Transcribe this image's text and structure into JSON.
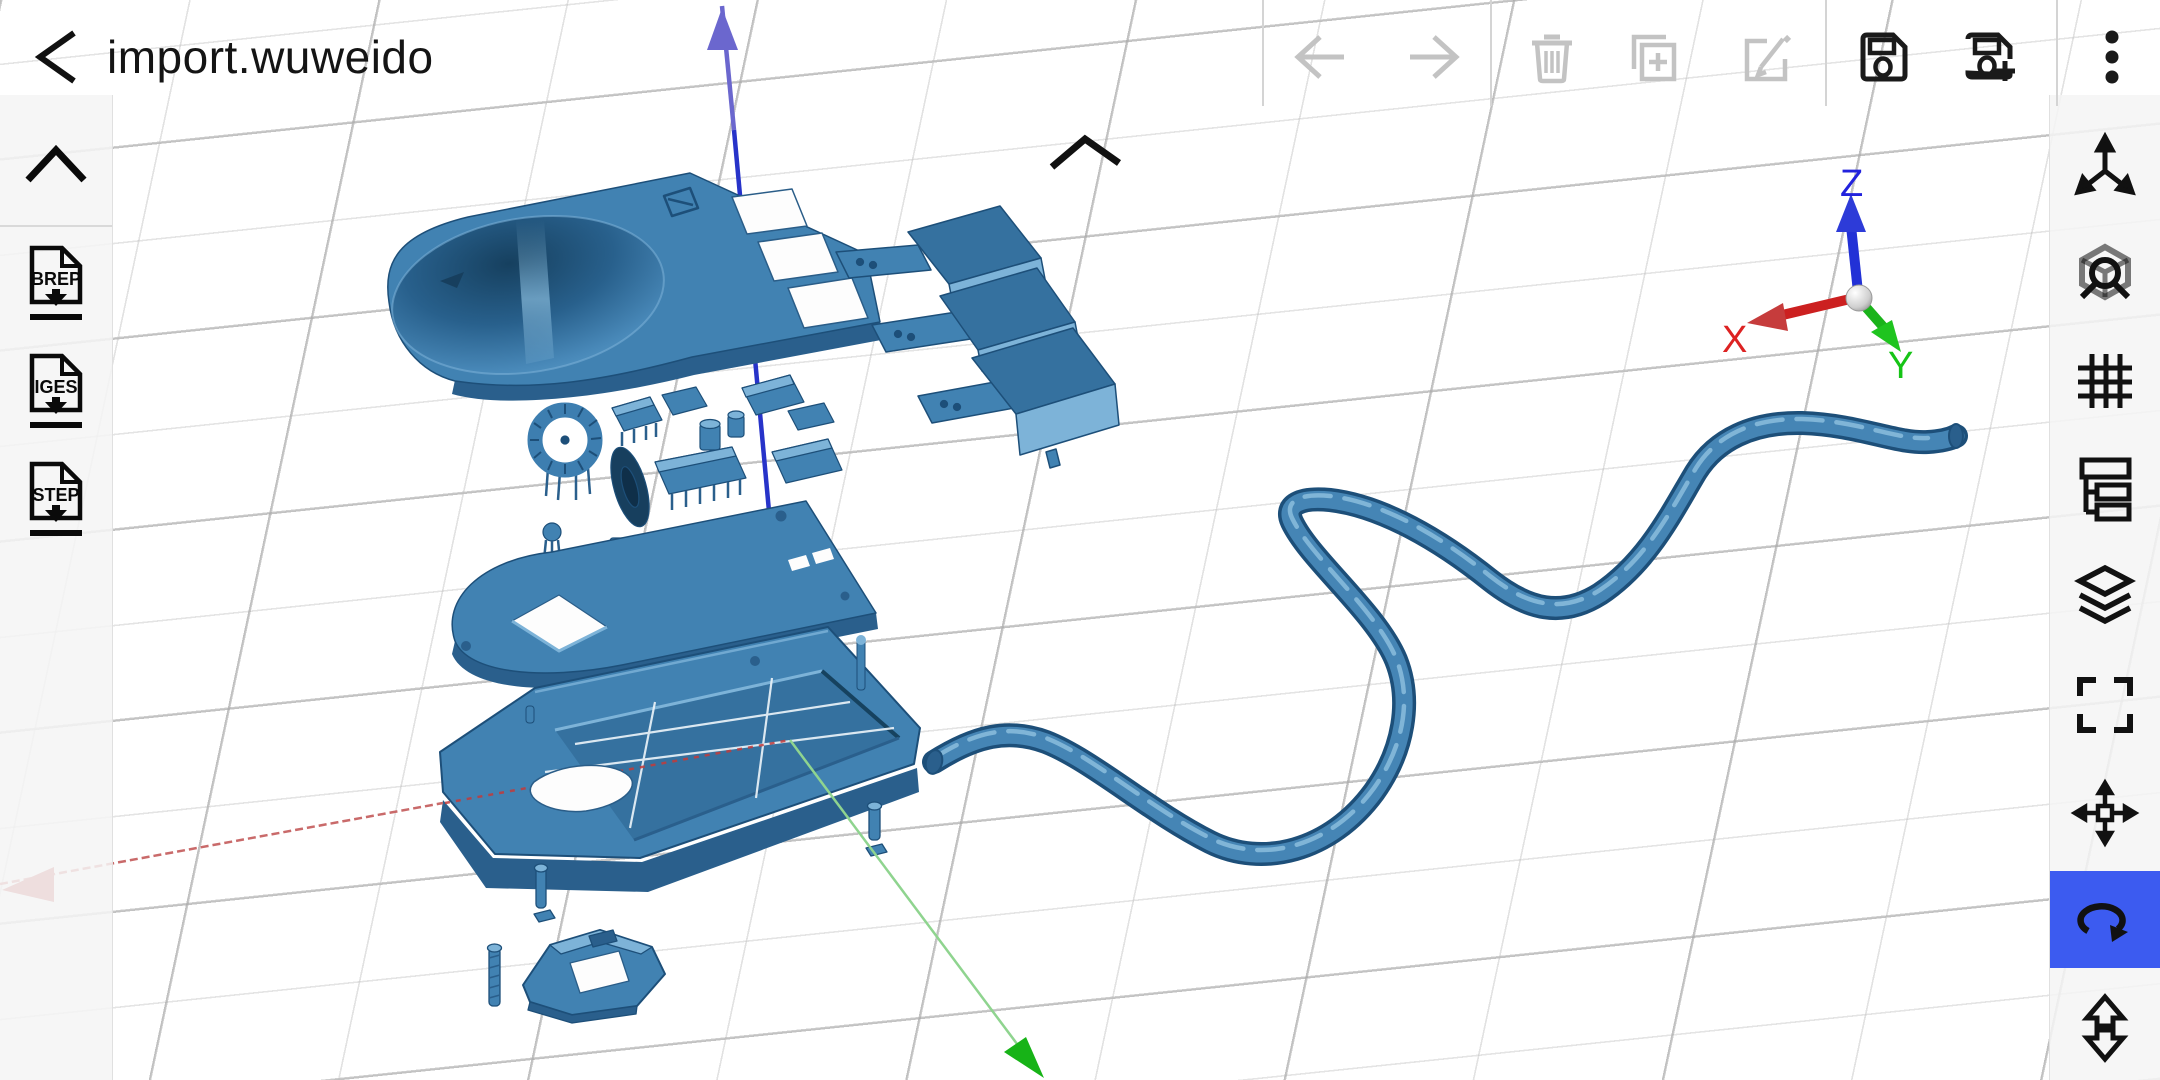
{
  "app": {
    "title": "import.wuweido"
  },
  "toolbar": {
    "back_icon": "back-chevron-icon",
    "items": [
      {
        "id": "undo",
        "icon": "undo-arrow-icon",
        "enabled": false
      },
      {
        "id": "redo",
        "icon": "redo-arrow-icon",
        "enabled": false
      },
      {
        "id": "delete",
        "icon": "trash-icon",
        "enabled": false
      },
      {
        "id": "duplicate",
        "icon": "duplicate-plus-icon",
        "enabled": false
      },
      {
        "id": "edit",
        "icon": "edit-pencil-icon",
        "enabled": false
      },
      {
        "id": "save",
        "icon": "save-floppy-icon",
        "enabled": true
      },
      {
        "id": "save_as",
        "icon": "save-as-plus-icon",
        "enabled": true
      },
      {
        "id": "menu",
        "icon": "overflow-menu-icon",
        "enabled": true
      }
    ]
  },
  "left_sidebar": {
    "collapse_icon": "chevron-up-icon",
    "import_buttons": [
      {
        "label": "BREP",
        "icon": "import-file-icon"
      },
      {
        "label": "IGES",
        "icon": "import-file-icon"
      },
      {
        "label": "STEP",
        "icon": "import-file-icon"
      }
    ]
  },
  "right_sidebar": {
    "active_tool": "rotate",
    "tools": [
      {
        "id": "axes",
        "icon": "axis-triad-icon"
      },
      {
        "id": "view-cube",
        "icon": "cube-magnifier-icon"
      },
      {
        "id": "grid",
        "icon": "grid-icon"
      },
      {
        "id": "structure",
        "icon": "structure-tree-icon"
      },
      {
        "id": "layers",
        "icon": "layers-icon"
      },
      {
        "id": "fit-view",
        "icon": "frame-corners-icon"
      },
      {
        "id": "move",
        "icon": "move-arrows-icon"
      },
      {
        "id": "rotate",
        "icon": "rotate-arrow-icon"
      },
      {
        "id": "scale",
        "icon": "double-arrow-icon"
      }
    ]
  },
  "viewport": {
    "expand_handle_icon": "chevron-up-icon",
    "axis_triad": {
      "x": "X",
      "y": "Y",
      "z": "Z"
    }
  },
  "colors": {
    "model-blue": "#4182b2",
    "model-blue-dark": "#1d4f79",
    "model-blue-light": "#7db3d8",
    "selection-blue": "#3c5bf0",
    "axis-x-red": "#cc2222",
    "axis-y-green": "#1ab31a",
    "axis-z-blue": "#2733c9",
    "grid-line": "#c9c9c9",
    "icon-enabled": "#1a1a1a",
    "icon-disabled": "#c3c3c3"
  }
}
